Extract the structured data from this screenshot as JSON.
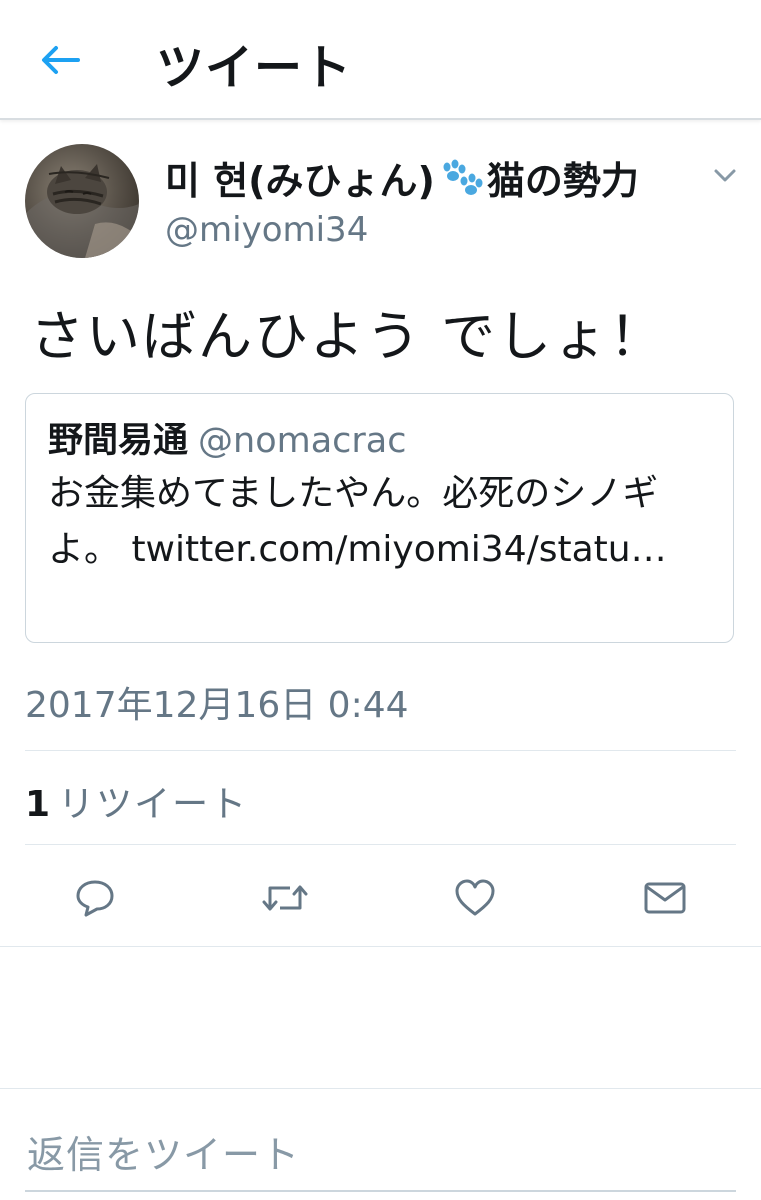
{
  "header": {
    "title": "ツイート",
    "back_icon": "arrow-left-icon"
  },
  "tweet": {
    "display_name_start": "미 현(みひょん)",
    "display_name_end": "猫の勢力",
    "name_icon": "paw-prints-icon",
    "handle": "@miyomi34",
    "text": "さいばんひよう でしょ！",
    "timestamp": "2017年12月16日 0:44",
    "retweet_count": "1",
    "retweet_label": "リツイート"
  },
  "quote": {
    "name": "野間易通",
    "handle": "@nomacrac",
    "text": "お金集めてましたやん。必死のシノギよ。 twitter.com/miyomi34/statu…"
  },
  "actions": {
    "icons": [
      "reply-icon",
      "retweet-icon",
      "like-icon",
      "direct-message-icon"
    ]
  },
  "reply": {
    "placeholder": "返信をツイート"
  },
  "colors": {
    "accent": "#1da1f2",
    "secondary_text": "#657786",
    "divider": "#e1e8ed",
    "paw": "#4aa8e0"
  }
}
